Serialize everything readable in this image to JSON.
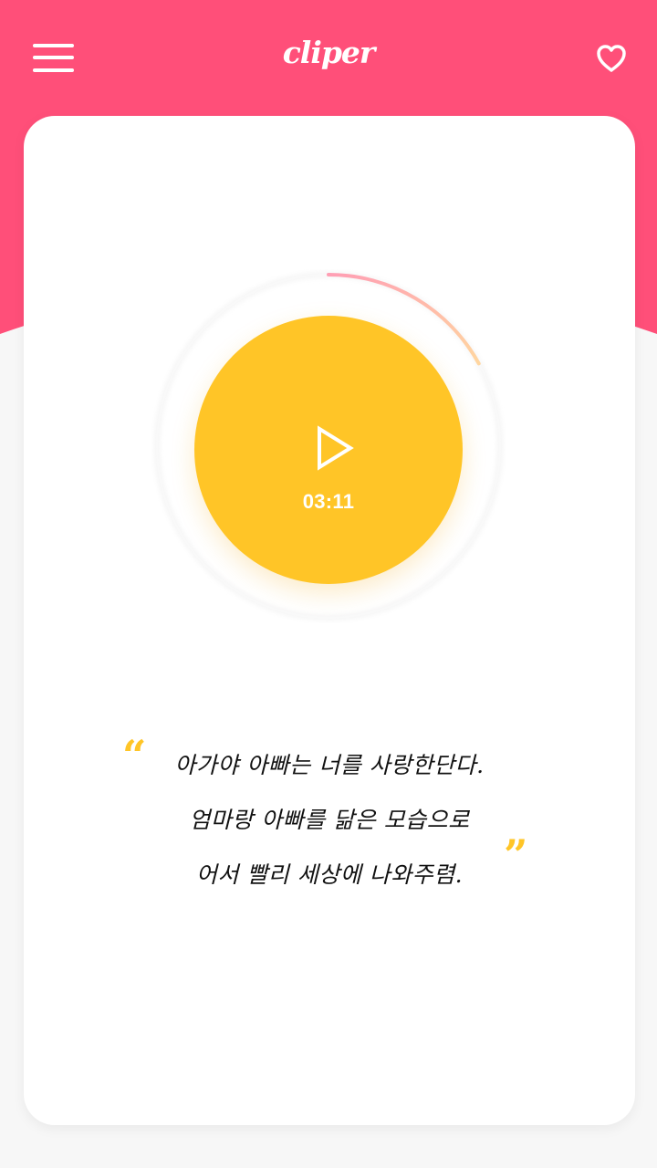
{
  "app": {
    "logo_text": "cliper"
  },
  "colors": {
    "header_pink": "#ff4f79",
    "player_yellow": "#ffc527",
    "progress_start": "#ff9fb4",
    "progress_end": "#ffd6a0",
    "card_white": "#ffffff",
    "background": "#f7f7f7"
  },
  "icons": {
    "menu": "hamburger-menu-icon",
    "favorite": "heart-outline-icon",
    "play": "play-triangle-icon"
  },
  "player": {
    "time": "03:11",
    "progress_fraction": 0.17
  },
  "quote": {
    "open_mark": "“",
    "close_mark": "”",
    "lines": [
      "아가야 아빠는 너를 사랑한단다.",
      "엄마랑 아빠를 닮은 모습으로",
      "어서 빨리 세상에 나와주렴."
    ]
  }
}
